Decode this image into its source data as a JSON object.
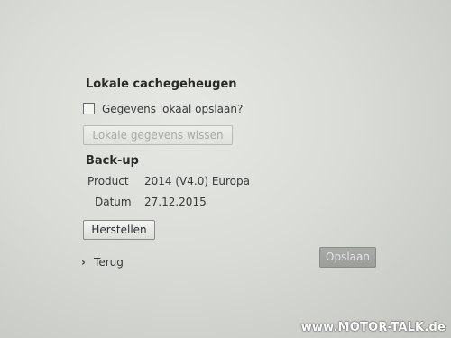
{
  "cache": {
    "title": "Lokale cachegeheugen",
    "checkbox_label": "Gegevens lokaal opslaan?",
    "checkbox_checked": false,
    "clear_button": "Lokale gegevens wissen"
  },
  "backup": {
    "title": "Back-up",
    "product_label": "Product",
    "product_value": "2014 (V4.0) Europa",
    "date_label": "Datum",
    "date_value": "27.12.2015",
    "restore_button": "Herstellen"
  },
  "footer": {
    "back_link": "Terug",
    "save_button": "Opslaan"
  },
  "watermark": "www.MOTOR-TALK.de"
}
